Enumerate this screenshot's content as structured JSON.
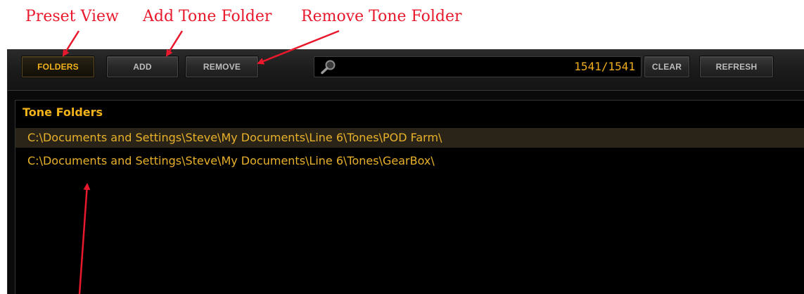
{
  "callouts": {
    "preset_view": "Preset View",
    "add_tone_folder": "Add Tone Folder",
    "remove_tone_folder": "Remove Tone Folder"
  },
  "toolbar": {
    "folders_label": "FOLDERS",
    "add_label": "ADD",
    "remove_label": "REMOVE",
    "clear_label": "CLEAR",
    "refresh_label": "REFRESH"
  },
  "search": {
    "value": "",
    "placeholder": "",
    "count": "1541/1541"
  },
  "list": {
    "header": "Tone Folders",
    "items": [
      {
        "path": "C:\\Documents and Settings\\Steve\\My Documents\\Line 6\\Tones\\POD Farm\\",
        "selected": true
      },
      {
        "path": "C:\\Documents and Settings\\Steve\\My Documents\\Line 6\\Tones\\GearBox\\",
        "selected": false
      }
    ]
  },
  "colors": {
    "annotation": "#e8192c",
    "accent_amber": "#f2b21a",
    "background": "#000000",
    "selected_row": "#2a2418"
  },
  "icons": {
    "search": "magnifier-icon"
  }
}
